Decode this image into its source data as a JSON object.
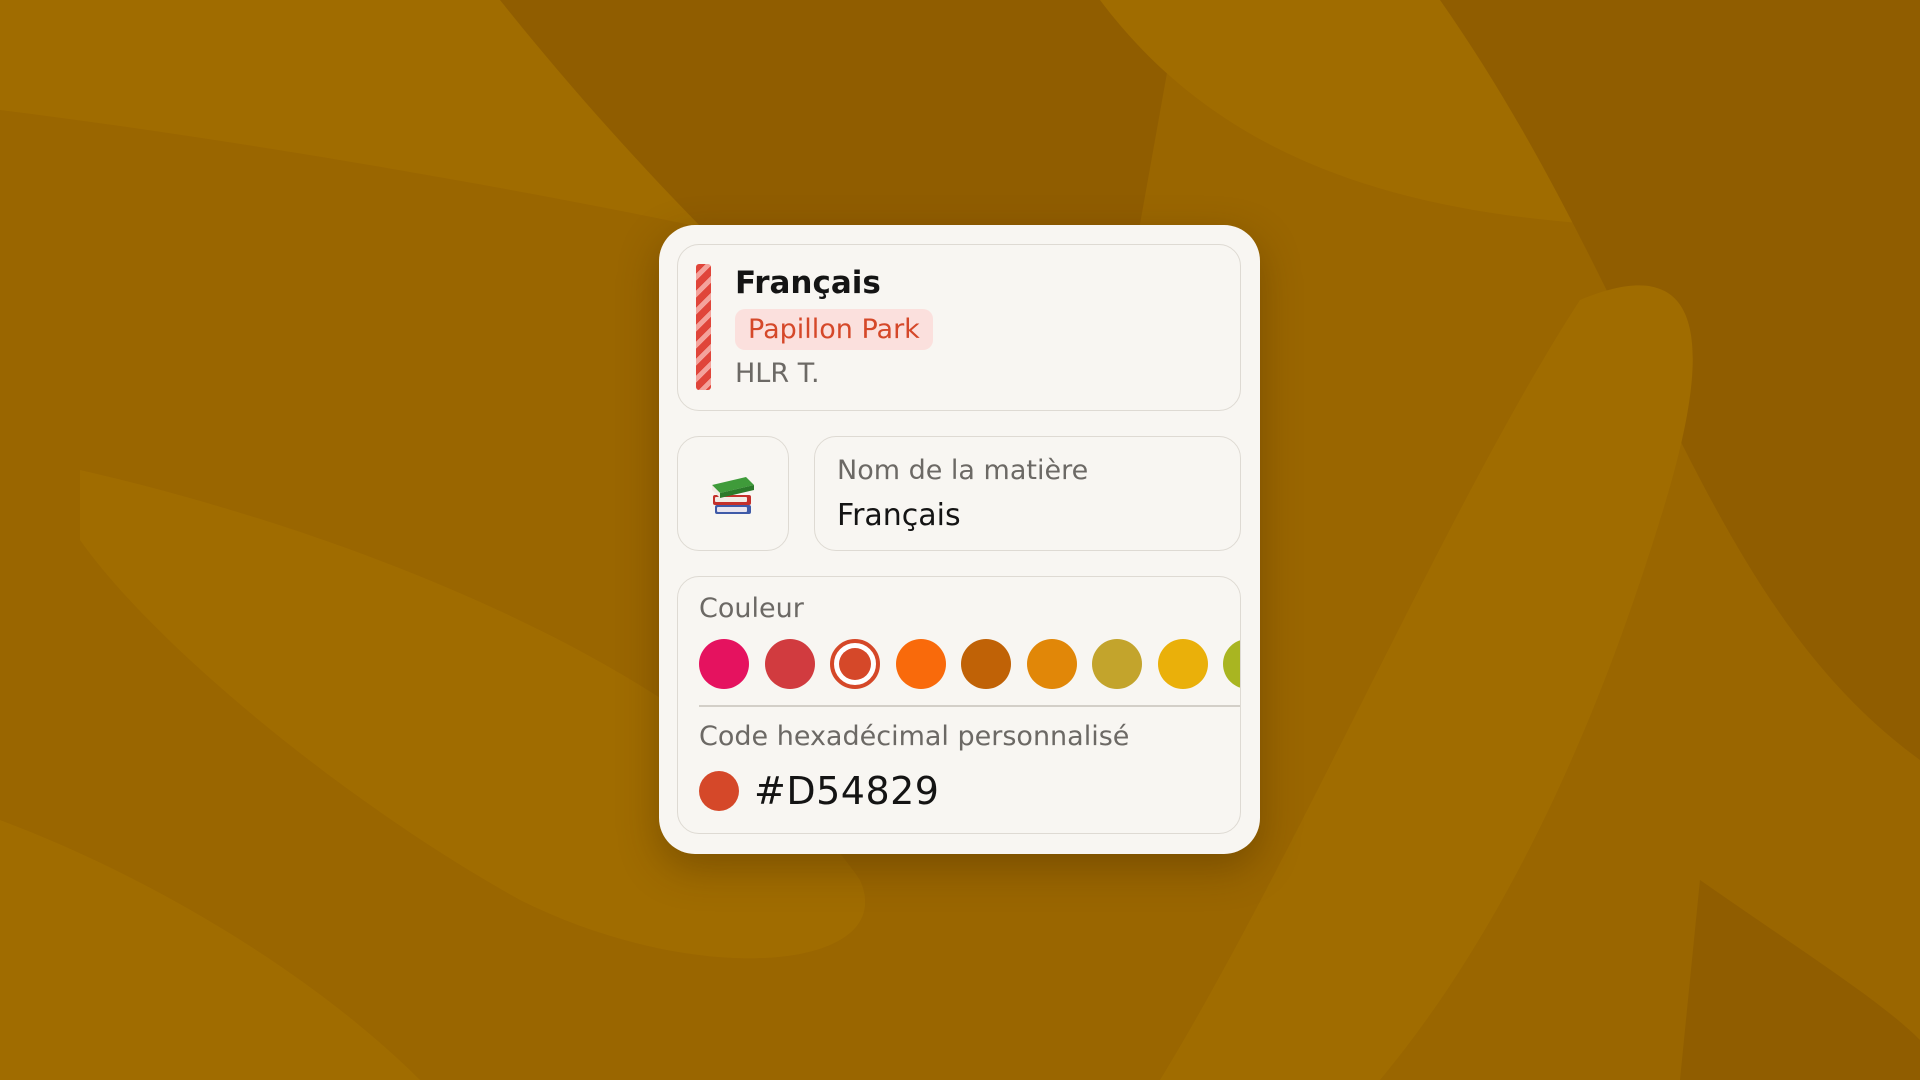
{
  "colors": {
    "background": "#9a6600",
    "card": "#f8f6f2",
    "accent": "#d54829",
    "accent_tint": "#fbe0dd"
  },
  "summary": {
    "subject": "Français",
    "room": "Papillon Park",
    "teacher": "HLR T."
  },
  "emoji_picker": {
    "icon": "books-icon"
  },
  "subject_name": {
    "label": "Nom de la matière",
    "value": "Français"
  },
  "color_picker": {
    "label": "Couleur",
    "swatches": [
      {
        "color": "#e5125f",
        "selected": false
      },
      {
        "color": "#d13b3f",
        "selected": false
      },
      {
        "color": "#d54829",
        "selected": true
      },
      {
        "color": "#f96a0b",
        "selected": false
      },
      {
        "color": "#c06206",
        "selected": false
      },
      {
        "color": "#e18708",
        "selected": false
      },
      {
        "color": "#c3a42c",
        "selected": false
      },
      {
        "color": "#eab00a",
        "selected": false
      },
      {
        "color": "#a9b521",
        "selected": false
      }
    ],
    "hex_label": "Code hexadécimal personnalisé",
    "hex_value": "#D54829"
  }
}
